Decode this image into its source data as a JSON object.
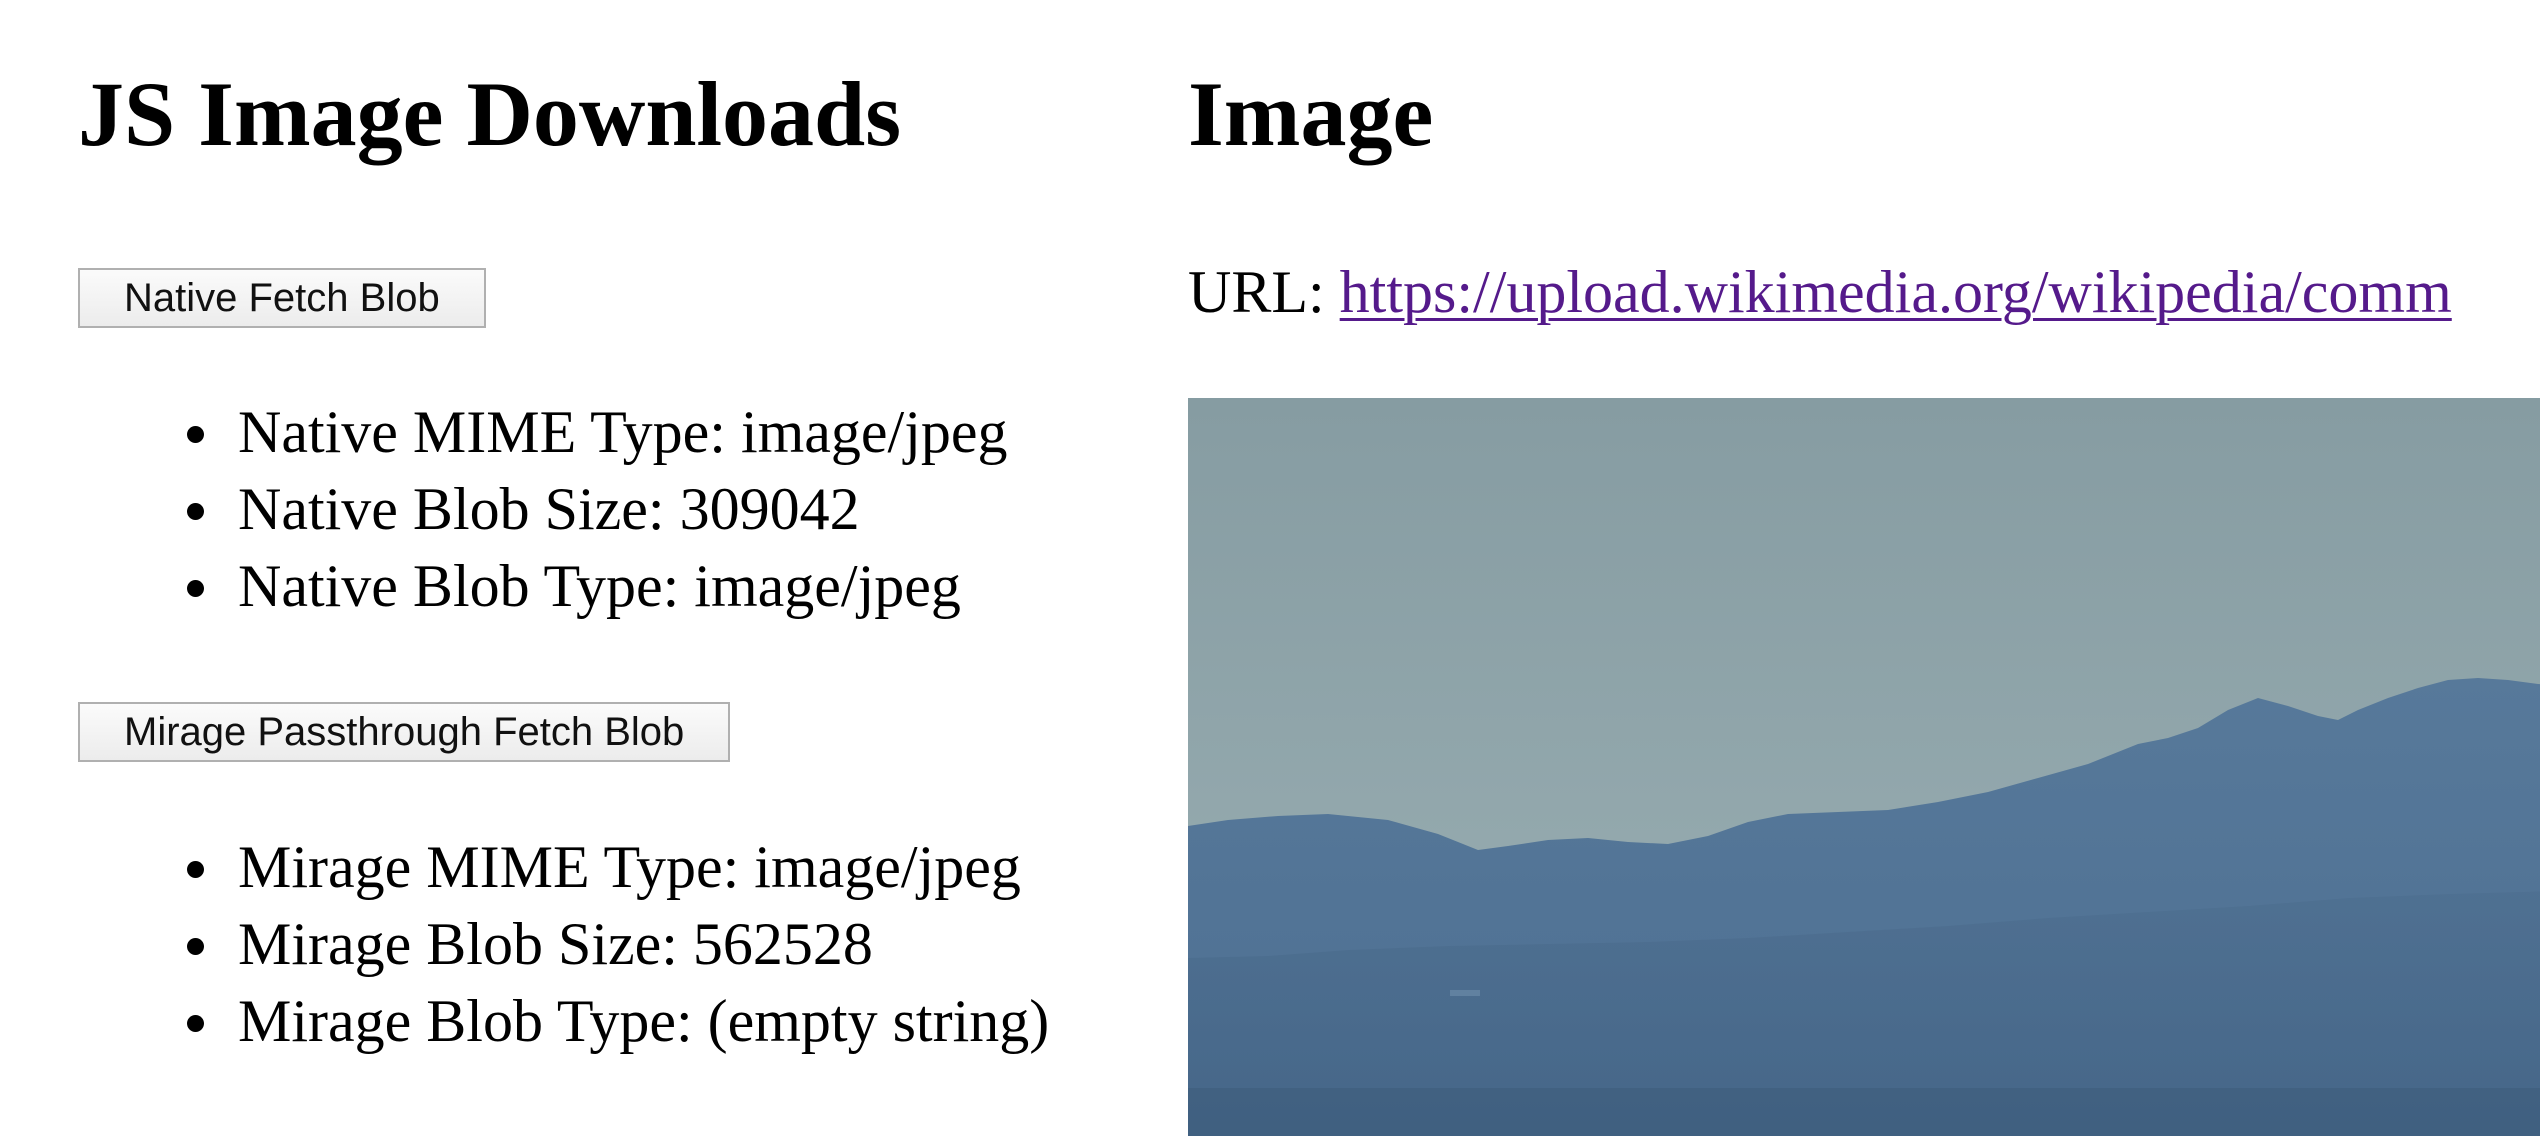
{
  "left": {
    "title": "JS Image Downloads",
    "native": {
      "button_label": "Native Fetch Blob",
      "items": [
        "Native MIME Type: image/jpeg",
        "Native Blob Size: 309042",
        "Native Blob Type: image/jpeg"
      ]
    },
    "mirage": {
      "button_label": "Mirage Passthrough Fetch Blob",
      "items": [
        "Mirage MIME Type: image/jpeg",
        "Mirage Blob Size: 562528",
        "Mirage Blob Type: (empty string)"
      ]
    }
  },
  "right": {
    "title": "Image",
    "url_label": "URL:",
    "url_text": "https://upload.wikimedia.org/wikipedia/comm",
    "image_alt": "mountain-landscape-image"
  },
  "colors": {
    "link": "#551a8b",
    "sky": "#8ba1a6",
    "mountains": "#4f7396"
  }
}
